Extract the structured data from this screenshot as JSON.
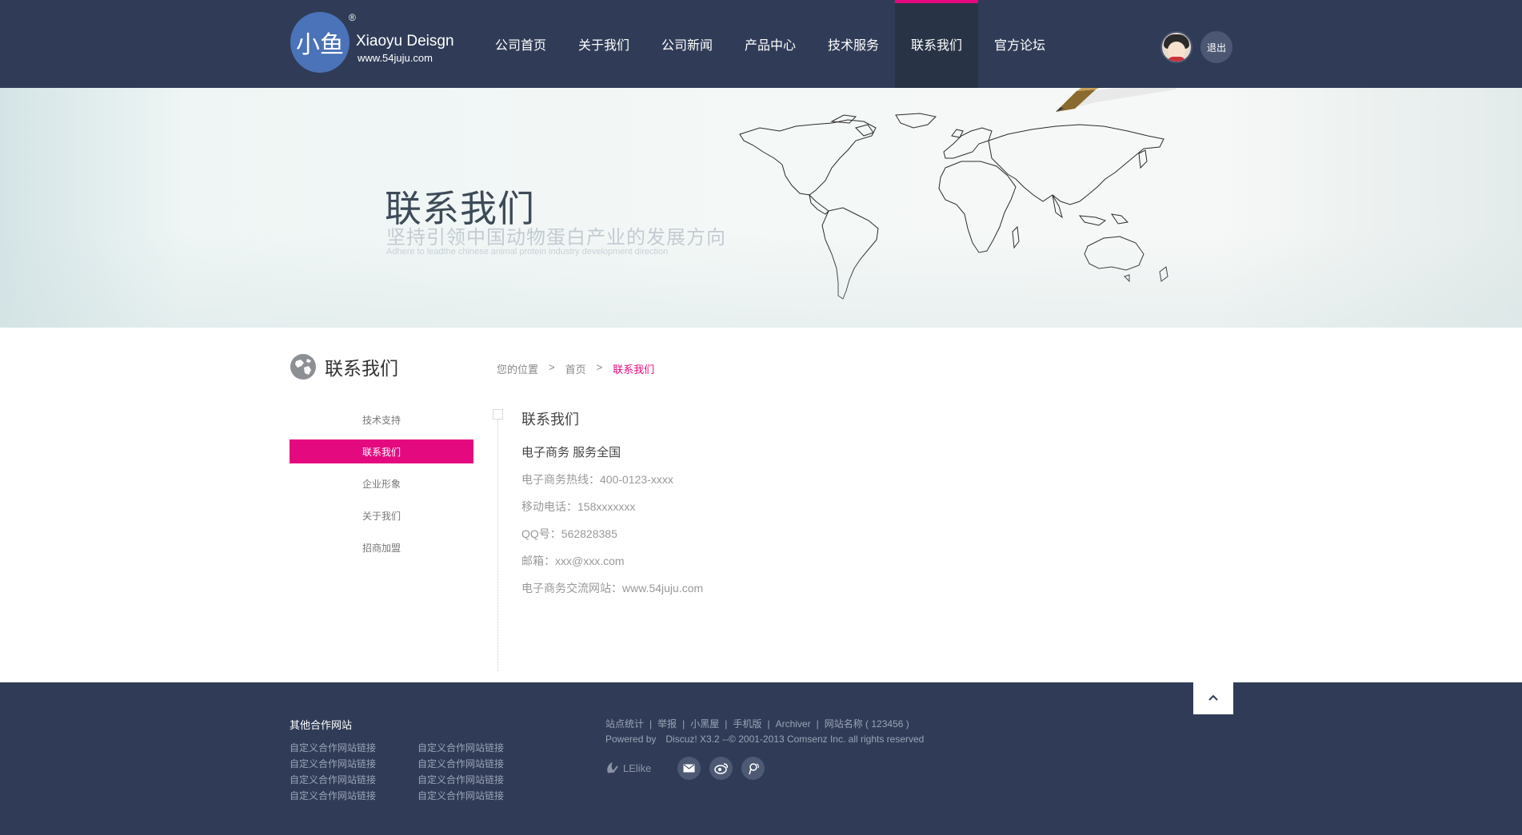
{
  "header": {
    "logo": {
      "mark": "小鱼",
      "reg": "®",
      "name": "Xiaoyu Deisgn",
      "url": "www.54juju.com"
    },
    "nav": [
      {
        "label": "公司首页",
        "active": false
      },
      {
        "label": "关于我们",
        "active": false
      },
      {
        "label": "公司新闻",
        "active": false
      },
      {
        "label": "产品中心",
        "active": false
      },
      {
        "label": "技术服务",
        "active": false
      },
      {
        "label": "联系我们",
        "active": true
      },
      {
        "label": "官方论坛",
        "active": false
      }
    ],
    "logout_label": "退出"
  },
  "banner": {
    "title": "联系我们",
    "subtitle": "坚持引领中国动物蛋白产业的发展方向",
    "subtitle_en": "Adhere to leadthe chinese animal protein industry development direction"
  },
  "sidebar": {
    "title": "联系我们",
    "items": [
      {
        "label": "技术支持",
        "active": false
      },
      {
        "label": "联系我们",
        "active": true
      },
      {
        "label": "企业形象",
        "active": false
      },
      {
        "label": "关于我们",
        "active": false
      },
      {
        "label": "招商加盟",
        "active": false
      }
    ]
  },
  "breadcrumb": {
    "prefix": "您的位置",
    "sep": ">",
    "home": "首页",
    "current": "联系我们"
  },
  "content": {
    "title": "联系我们",
    "headline": "电子商务 服务全国",
    "lines": [
      "电子商务热线：400-0123-xxxx",
      "移动电话：158xxxxxxx",
      "QQ号：562828385",
      "邮箱：xxx@xxx.com",
      "电子商务交流网站：www.54juju.com"
    ]
  },
  "footer": {
    "partners_title": "其他合作网站",
    "partners": [
      "自定义合作网站链接",
      "自定义合作网站链接",
      "自定义合作网站链接",
      "自定义合作网站链接",
      "自定义合作网站链接",
      "自定义合作网站链接",
      "自定义合作网站链接",
      "自定义合作网站链接"
    ],
    "links": [
      "站点统计",
      "举报",
      "小黑屋",
      "手机版",
      "Archiver",
      "网站名称 ( 123456 )"
    ],
    "link_sep": "|",
    "powered_by": "Powered by",
    "powered_text": "Discuz! X3.2 --© 2001-2013 Comsenz Inc.   all rights reserved",
    "lelike": "LElike"
  },
  "colors": {
    "header_bg": "#303c57",
    "accent": "#e5097f",
    "footer_bg": "#303c57"
  }
}
